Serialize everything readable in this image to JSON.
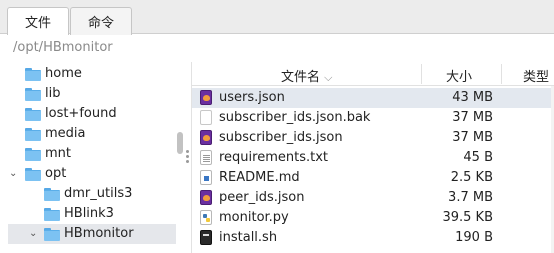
{
  "tabs": [
    {
      "label": "文件",
      "active": true
    },
    {
      "label": "命令",
      "active": false
    }
  ],
  "path": "/opt/HBmonitor",
  "tree": [
    {
      "label": "home"
    },
    {
      "label": "lib"
    },
    {
      "label": "lost+found"
    },
    {
      "label": "media"
    },
    {
      "label": "mnt"
    },
    {
      "label": "opt",
      "expanded": true
    },
    {
      "label": "dmr_utils3"
    },
    {
      "label": "HBlink3"
    },
    {
      "label": "HBmonitor",
      "selected": true,
      "expanded": true
    }
  ],
  "list": {
    "columns": {
      "name": "文件名",
      "sort_indicator": "⌵",
      "size": "大小",
      "type": "类型"
    },
    "files": [
      {
        "name": "users.json",
        "size": "43 MB",
        "icon": "json-file-icon",
        "selected": true
      },
      {
        "name": "subscriber_ids.json.bak",
        "size": "37 MB",
        "icon": "bak-file-icon"
      },
      {
        "name": "subscriber_ids.json",
        "size": "37 MB",
        "icon": "json-file-icon"
      },
      {
        "name": "requirements.txt",
        "size": "45 B",
        "icon": "text-file-icon"
      },
      {
        "name": "README.md",
        "size": "2.5 KB",
        "icon": "markdown-file-icon"
      },
      {
        "name": "peer_ids.json",
        "size": "3.7 MB",
        "icon": "json-file-icon"
      },
      {
        "name": "monitor.py",
        "size": "39.5 KB",
        "icon": "python-file-icon"
      },
      {
        "name": "install.sh",
        "size": "190 B",
        "icon": "shell-file-icon"
      }
    ]
  },
  "colors": {
    "folder": "#7cc2f2",
    "selection": "#e3e8ef",
    "tab_bar": "#ececec"
  }
}
